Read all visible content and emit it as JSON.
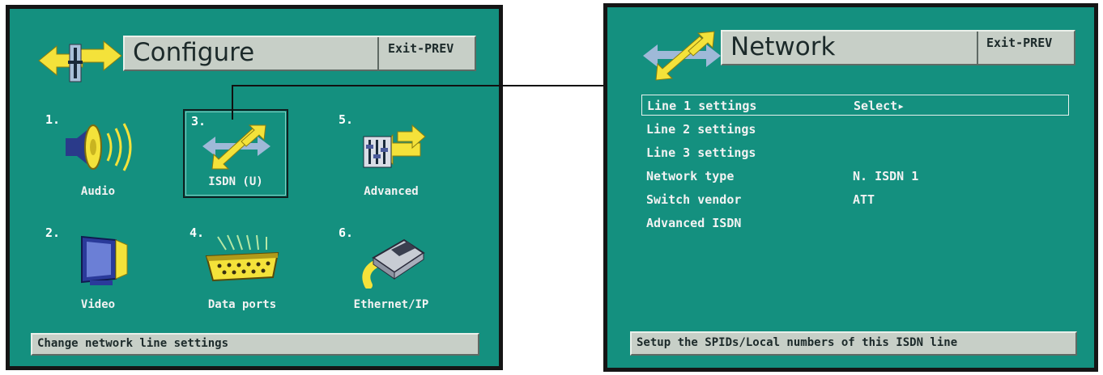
{
  "configure": {
    "title": "Configure",
    "exit": "Exit-PREV",
    "tiles": [
      {
        "number": "1.",
        "label": "Audio",
        "icon": "speaker-icon"
      },
      {
        "number": "3.",
        "label": "ISDN (U)",
        "icon": "network-arrows-icon",
        "selected": true
      },
      {
        "number": "5.",
        "label": "Advanced",
        "icon": "advanced-sliders-icon"
      },
      {
        "number": "2.",
        "label": "Video",
        "icon": "monitor-icon"
      },
      {
        "number": "4.",
        "label": "Data ports",
        "icon": "data-port-connector-icon"
      },
      {
        "number": "6.",
        "label": "Ethernet/IP",
        "icon": "ethernet-plug-icon"
      }
    ],
    "status": "Change network line settings"
  },
  "network": {
    "title": "Network",
    "exit": "Exit-PREV",
    "rows": [
      {
        "label": "Line 1 settings",
        "value": "Select▸",
        "highlighted": true
      },
      {
        "label": "Line 2 settings",
        "value": ""
      },
      {
        "label": "Line 3 settings",
        "value": ""
      },
      {
        "label": "Network type",
        "value": "N. ISDN 1"
      },
      {
        "label": "Switch vendor",
        "value": "ATT"
      },
      {
        "label": "Advanced ISDN",
        "value": ""
      }
    ],
    "status": "Setup the SPIDs/Local numbers of this ISDN line"
  },
  "colors": {
    "screen_bg": "#14907f",
    "bar_bg": "#c7cfc7",
    "arrow_yellow": "#f4e23a",
    "arrow_blue": "#9fb9d8"
  }
}
